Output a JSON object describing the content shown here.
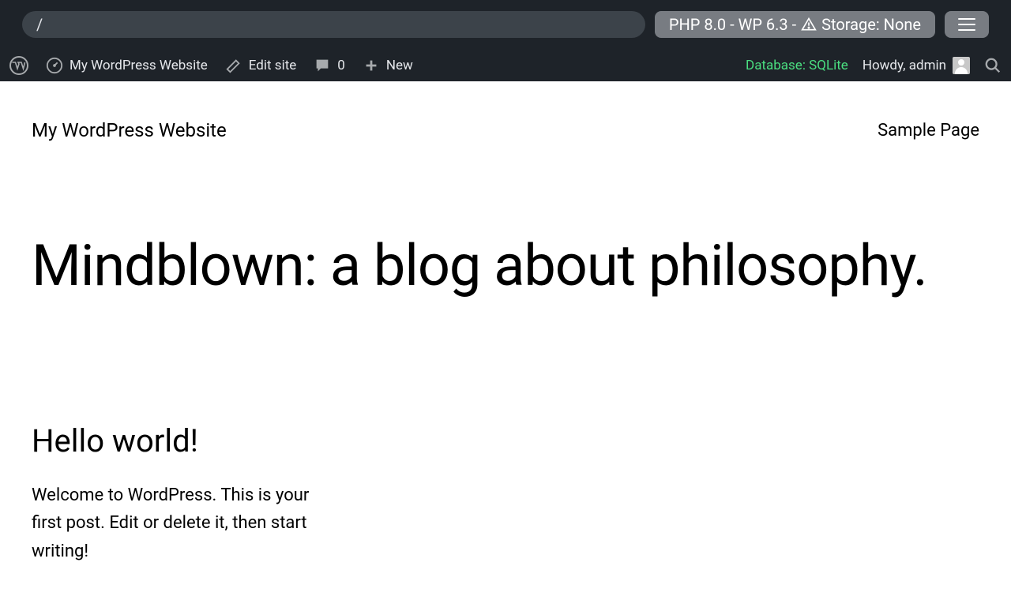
{
  "playground": {
    "url": "/",
    "storage_label_prefix": "PHP 8.0 - WP 6.3 - ",
    "storage_label_suffix": " Storage: None"
  },
  "adminbar": {
    "site_name": "My WordPress Website",
    "edit_site": "Edit site",
    "comments_count": "0",
    "new_label": "New",
    "database_label": "Database: SQLite",
    "howdy": "Howdy, admin"
  },
  "site": {
    "title": "My WordPress Website",
    "nav": {
      "sample_page": "Sample Page"
    },
    "hero_heading": "Mindblown: a blog about philosophy.",
    "post": {
      "title": "Hello world!",
      "excerpt": "Welcome to WordPress. This is your first post. Edit or delete it, then start writing!"
    }
  }
}
